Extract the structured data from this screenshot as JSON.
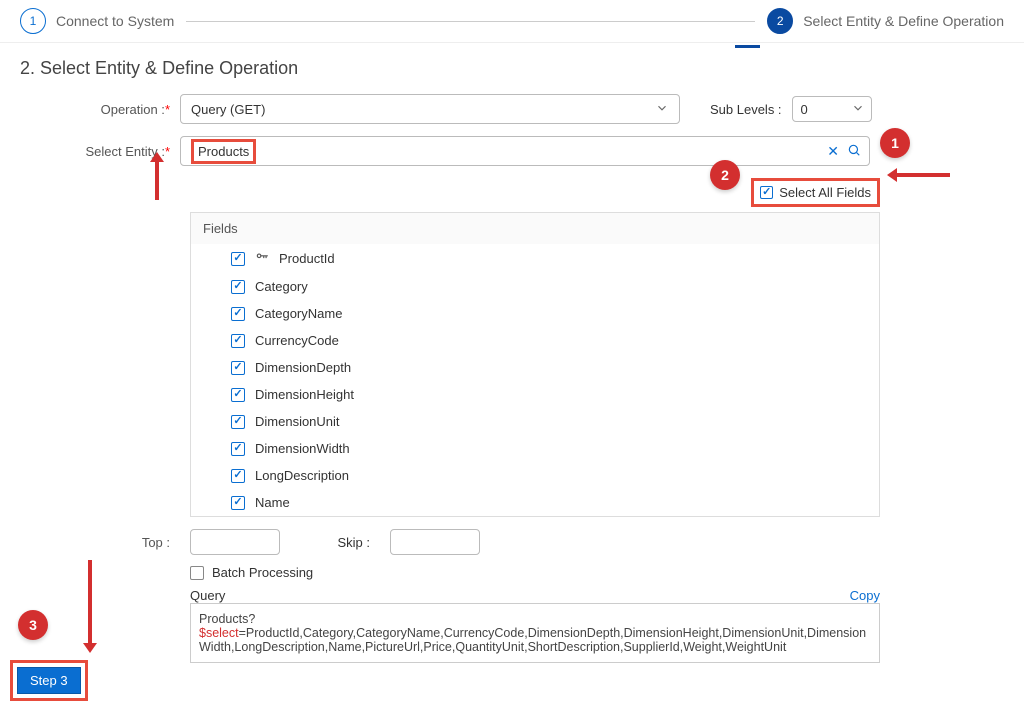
{
  "stepper": {
    "step1_num": "1",
    "step1_label": "Connect to System",
    "step2_num": "2",
    "step2_label": "Select Entity & Define Operation"
  },
  "title": "2. Select Entity & Define Operation",
  "labels": {
    "operation": "Operation :",
    "select_entity": "Select Entity :",
    "sub_levels": "Sub Levels :",
    "select_all": "Select All Fields",
    "fields": "Fields",
    "top": "Top :",
    "skip": "Skip :",
    "batch": "Batch Processing",
    "query": "Query",
    "copy": "Copy"
  },
  "values": {
    "operation": "Query (GET)",
    "entity": "Products",
    "sub_levels": "0",
    "top": "",
    "skip": ""
  },
  "fields": [
    {
      "name": "ProductId",
      "checked": true,
      "key": true
    },
    {
      "name": "Category",
      "checked": true,
      "key": false
    },
    {
      "name": "CategoryName",
      "checked": true,
      "key": false
    },
    {
      "name": "CurrencyCode",
      "checked": true,
      "key": false
    },
    {
      "name": "DimensionDepth",
      "checked": true,
      "key": false
    },
    {
      "name": "DimensionHeight",
      "checked": true,
      "key": false
    },
    {
      "name": "DimensionUnit",
      "checked": true,
      "key": false
    },
    {
      "name": "DimensionWidth",
      "checked": true,
      "key": false
    },
    {
      "name": "LongDescription",
      "checked": true,
      "key": false
    },
    {
      "name": "Name",
      "checked": true,
      "key": false
    }
  ],
  "query_prefix": "Products?",
  "query_select": "$select",
  "query_rest": "=ProductId,Category,CategoryName,CurrencyCode,DimensionDepth,DimensionHeight,DimensionUnit,DimensionWidth,LongDescription,Name,PictureUrl,Price,QuantityUnit,ShortDescription,SupplierId,Weight,WeightUnit",
  "annotations": {
    "a1": "1",
    "a2": "2",
    "a3": "3"
  },
  "step3_btn": "Step 3"
}
